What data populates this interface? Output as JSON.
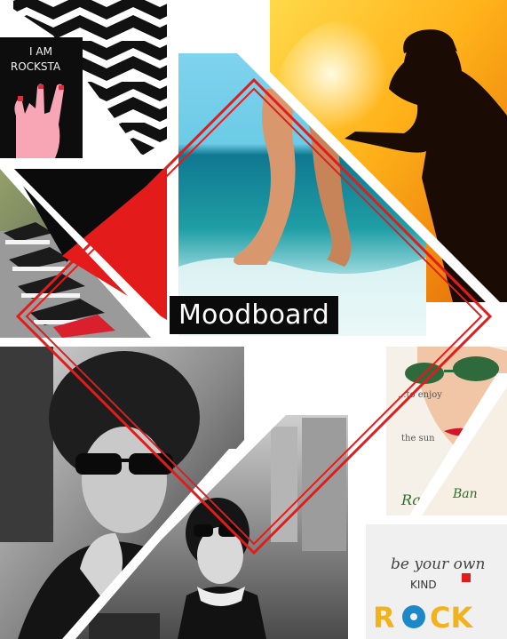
{
  "title": "Moodboard",
  "collage": {
    "tiles": [
      {
        "name": "chevron-pattern-tile",
        "caption": ""
      },
      {
        "name": "rockstar-hand-tile",
        "caption": "I AM A ROCKSTAR"
      },
      {
        "name": "sunset-silhouette-tile",
        "caption": ""
      },
      {
        "name": "beach-legs-tile",
        "caption": ""
      },
      {
        "name": "sneakers-tile",
        "caption": ""
      },
      {
        "name": "black-red-triangle-tile",
        "caption": ""
      },
      {
        "name": "curly-hair-sunglasses-portrait-tile",
        "caption": ""
      },
      {
        "name": "city-street-portrait-tile",
        "caption": ""
      },
      {
        "name": "rayban-ad-tile",
        "caption": "...to enjoy the sun ... style  Ray-Ban"
      },
      {
        "name": "be-your-own-kind-rock-tile",
        "caption": "be your own KIND OF ROCK"
      }
    ]
  },
  "colors": {
    "accent_red": "#e31b1b",
    "title_bg": "#0b0b0b",
    "title_text": "#ffffff"
  }
}
